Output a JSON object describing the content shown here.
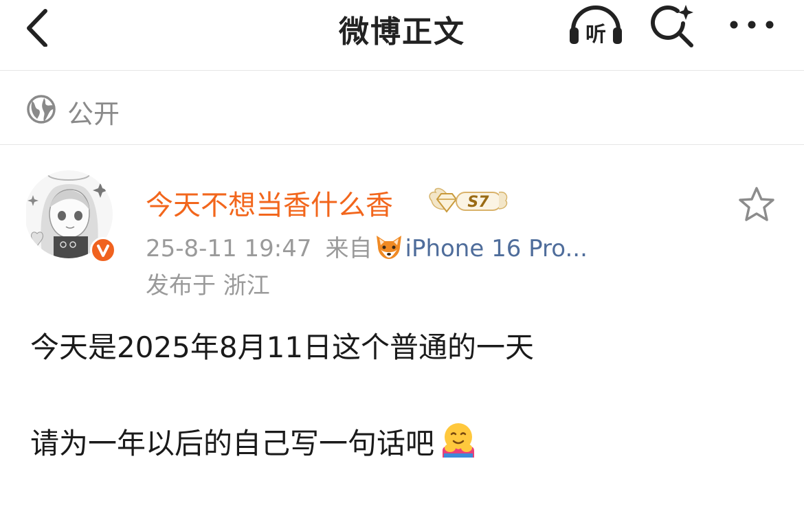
{
  "header": {
    "title": "微博正文",
    "back_icon": "chevron-left-icon",
    "listen_label": "听",
    "search_icon": "search-sparkle-icon",
    "more_icon": "more-horizontal-icon"
  },
  "visibility": {
    "icon": "globe-icon",
    "label": "公开"
  },
  "author": {
    "name": "今天不想当香什么香",
    "name_color": "#f2661c",
    "level_badge_text": "S7",
    "verified_icon": "vip-v-icon",
    "timestamp": "25-8-11 19:47",
    "source_prefix": "来自",
    "source_icon": "fox-emoji-icon",
    "device": "iPhone 16 Pro...",
    "location": "发布于 浙江"
  },
  "post": {
    "line1": "今天是2025年8月11日这个普通的一天",
    "line2": "请为一年以后的自己写一句话吧",
    "emoji_icon": "hugging-face-icon"
  },
  "actions": {
    "favorite_icon": "star-outline-icon"
  },
  "colors": {
    "accent_orange": "#f2661c",
    "link_blue": "#4f6d9b",
    "meta_gray": "#9a9a9a"
  }
}
